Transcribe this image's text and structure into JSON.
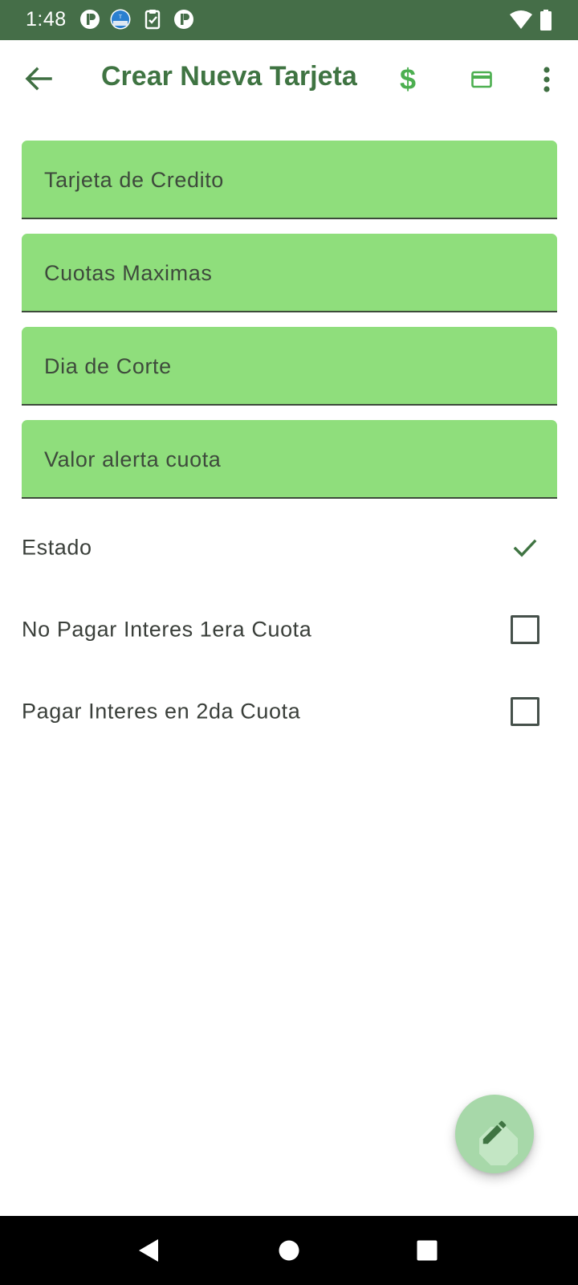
{
  "status_bar": {
    "time": "1:48",
    "background": "#456e48",
    "notification_icons": [
      "app-notification-icon",
      "weather-notification-icon",
      "clipboard-check-notification-icon",
      "app-notification-icon"
    ],
    "system_icons": [
      "wifi-icon",
      "battery-icon"
    ]
  },
  "app_bar": {
    "title": "Crear Nueva Tarjeta",
    "back_icon": "arrow-back-icon",
    "actions": [
      "dollar-icon",
      "credit-card-icon",
      "more-vert-icon"
    ],
    "title_color": "#3f7442"
  },
  "form": {
    "fields": [
      {
        "placeholder": "Tarjeta de Credito",
        "value": ""
      },
      {
        "placeholder": "Cuotas Maximas",
        "value": ""
      },
      {
        "placeholder": "Dia de Corte",
        "value": ""
      },
      {
        "placeholder": "Valor alerta cuota",
        "value": ""
      }
    ],
    "field_background": "#8fde7c",
    "toggles": [
      {
        "label": "Estado",
        "checked": true,
        "style": "checkmark"
      },
      {
        "label": "No Pagar Interes 1era Cuota",
        "checked": false,
        "style": "checkbox"
      },
      {
        "label": "Pagar Interes en 2da Cuota",
        "checked": false,
        "style": "checkbox"
      }
    ]
  },
  "fab": {
    "icon": "edit-pencil-icon",
    "background": "#a7d8a9"
  },
  "navigation_bar": {
    "buttons": [
      "back-triangle-icon",
      "home-circle-icon",
      "recents-square-icon"
    ]
  },
  "colors": {
    "primary_dark": "#456e48",
    "accent": "#4caf50",
    "check": "#3f7442"
  }
}
